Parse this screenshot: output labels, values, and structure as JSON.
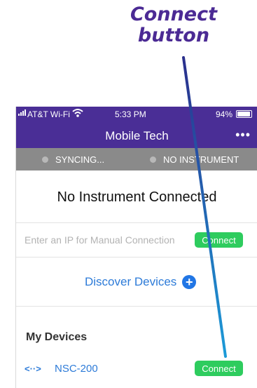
{
  "annotation": {
    "line1": "Connect",
    "line2": "button",
    "color": "#4b2a94",
    "arrow_color": "#1c6fd1"
  },
  "status_bar": {
    "carrier": "AT&T Wi-Fi",
    "time": "5:33 PM",
    "battery": "94%"
  },
  "nav": {
    "title": "Mobile Tech",
    "more_glyph": "•••",
    "color": "#4a2e96"
  },
  "sync_bar": {
    "sync_status": "SYNCING...",
    "instrument_status": "NO INSTRUMENT"
  },
  "main": {
    "heading": "No Instrument Connected",
    "ip_placeholder": "Enter an IP for Manual Connection",
    "connect_label": "Connect",
    "discover_label": "Discover Devices",
    "discover_icon": "plus-circle-icon"
  },
  "my_devices": {
    "title": "My Devices",
    "items": [
      {
        "icon": "network-device-icon",
        "glyph": "<··>",
        "name": "NSC-200",
        "action": "Connect"
      }
    ]
  },
  "colors": {
    "accent_green": "#2ecc5e",
    "link_blue": "#2d7bd8"
  }
}
